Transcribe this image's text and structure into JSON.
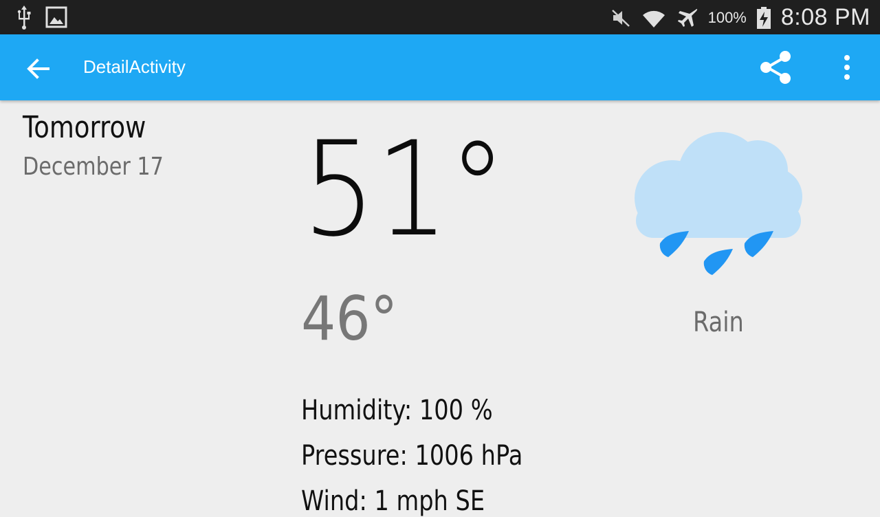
{
  "status_bar": {
    "icons_left": [
      "usb-icon",
      "image-icon"
    ],
    "icons_right": [
      "mute-icon",
      "wifi-icon",
      "airplane-icon",
      "battery-charging-icon"
    ],
    "battery_percent": "100%",
    "time": "8:08 PM"
  },
  "app_bar": {
    "title": "DetailActivity",
    "back_icon": "arrow-back-icon",
    "share_icon": "share-icon",
    "overflow_icon": "more-vert-icon",
    "color": "#1ea8f4"
  },
  "forecast": {
    "day": "Tomorrow",
    "date": "December 17",
    "high": "51°",
    "low": "46°",
    "condition": "Rain",
    "icon": "rain-cloud-icon",
    "humidity": "Humidity: 100 %",
    "pressure": "Pressure: 1006 hPa",
    "wind": "Wind: 1 mph SE"
  },
  "colors": {
    "background": "#eeeeee",
    "status_bar": "#1f1f1f",
    "cloud": "#bfe0f8",
    "raindrop": "#2196f3"
  }
}
